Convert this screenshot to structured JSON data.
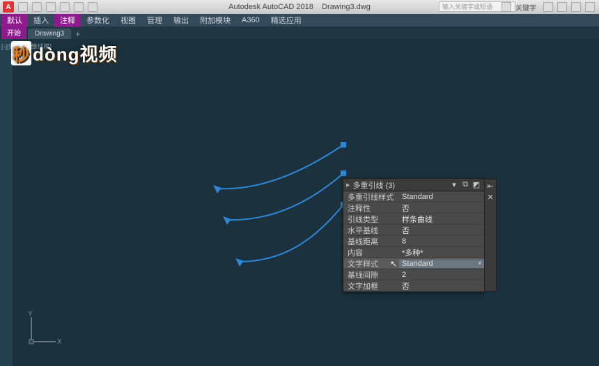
{
  "app": {
    "title_left": "Autodesk AutoCAD 2018",
    "title_doc": "Drawing3.dwg",
    "search_placeholder": "输入关键字或短语",
    "keyword_label": "关键字"
  },
  "menu": {
    "items": [
      "默认",
      "插入",
      "注释",
      "参数化",
      "视图",
      "管理",
      "输出",
      "附加模块",
      "A360",
      "精选应用"
    ]
  },
  "doc_tabs": {
    "start": "开始",
    "active": "Drawing3",
    "add_icon": "+"
  },
  "watermark": {
    "part1": "秒",
    "rest": "dòng视频"
  },
  "viewport_label": "[-][俯视][二维线框]",
  "ucs": {
    "x": "X",
    "y": "Y"
  },
  "palette": {
    "title": "多重引线 (3)",
    "rows": [
      {
        "label": "多重引线样式",
        "value": "Standard"
      },
      {
        "label": "注释性",
        "value": "否"
      },
      {
        "label": "引线类型",
        "value": "样条曲线"
      },
      {
        "label": "水平基线",
        "value": "否"
      },
      {
        "label": "基线距离",
        "value": "8"
      },
      {
        "label": "内容",
        "value": "*多种*"
      },
      {
        "label": "文字样式",
        "value": "Standard",
        "selected": true,
        "dropdown": true
      },
      {
        "label": "基线间隙",
        "value": "2"
      },
      {
        "label": "文字加框",
        "value": "否"
      }
    ]
  }
}
